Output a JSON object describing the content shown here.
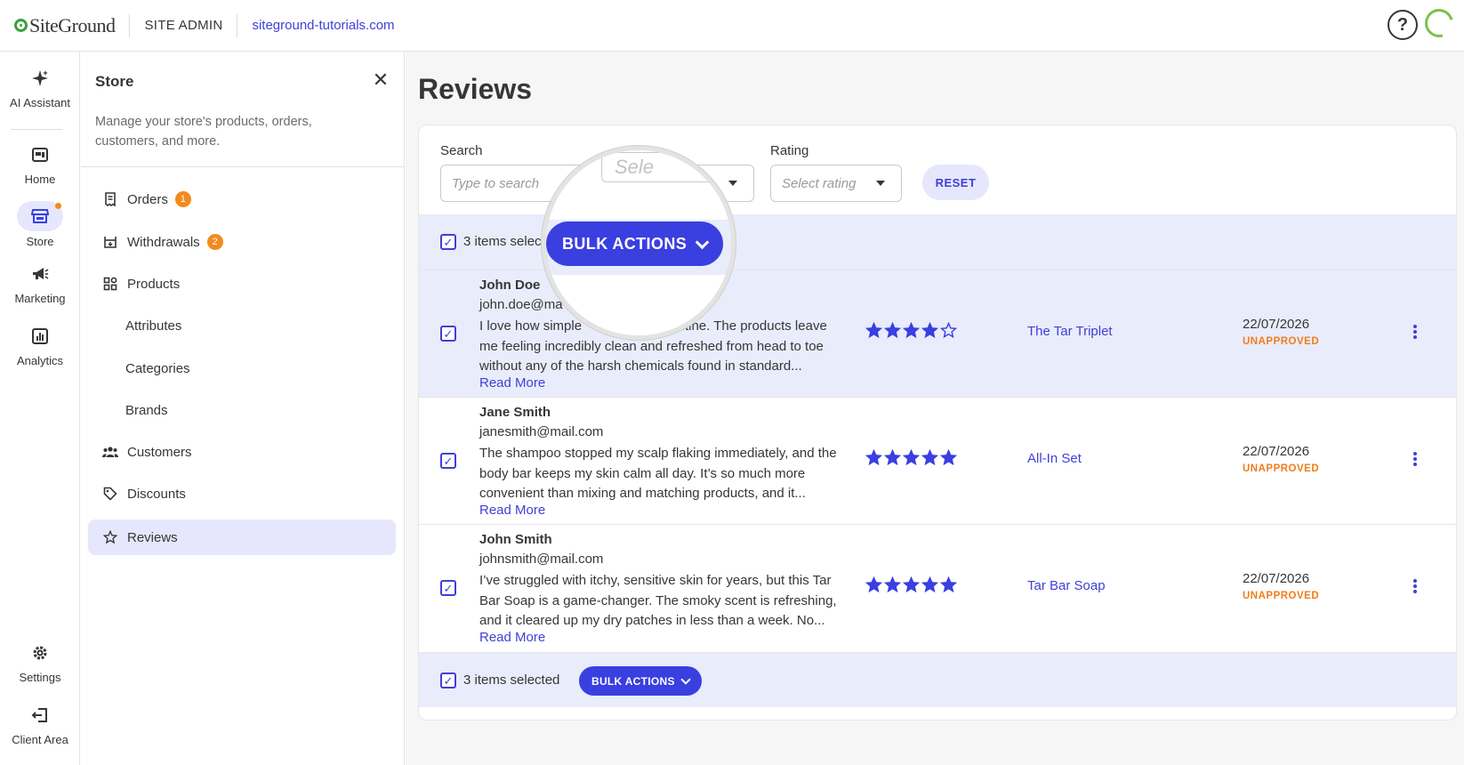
{
  "topbar": {
    "logo_text": "SiteGround",
    "section": "SITE ADMIN",
    "domain": "siteground-tutorials.com",
    "help_glyph": "?"
  },
  "rail": {
    "items": [
      {
        "label": "AI Assistant",
        "icon": "sparkle-icon"
      },
      {
        "label": "Home",
        "icon": "home-icon"
      },
      {
        "label": "Store",
        "icon": "store-icon",
        "active": true
      },
      {
        "label": "Marketing",
        "icon": "megaphone-icon"
      },
      {
        "label": "Analytics",
        "icon": "analytics-icon"
      },
      {
        "label": "Settings",
        "icon": "gear-icon"
      },
      {
        "label": "Client Area",
        "icon": "exit-icon"
      }
    ]
  },
  "panel": {
    "title": "Store",
    "description": "Manage your store's products, orders, customers, and more.",
    "nav": [
      {
        "label": "Orders",
        "badge": "1",
        "icon": "receipt-icon"
      },
      {
        "label": "Withdrawals",
        "badge": "2",
        "icon": "withdrawal-icon"
      },
      {
        "label": "Products",
        "icon": "products-icon"
      },
      {
        "label": "Attributes"
      },
      {
        "label": "Categories"
      },
      {
        "label": "Brands"
      },
      {
        "label": "Customers",
        "icon": "customers-icon"
      },
      {
        "label": "Discounts",
        "icon": "tag-icon"
      },
      {
        "label": "Reviews",
        "icon": "star-icon",
        "active": true
      }
    ]
  },
  "main": {
    "title": "Reviews",
    "filters": {
      "search_label": "Search",
      "search_placeholder": "Type to search",
      "status_placeholder": "Sele",
      "rating_label": "Rating",
      "rating_placeholder": "Select rating",
      "reset_label": "RESET"
    },
    "bulk_top": {
      "selected_text": "3 items selec",
      "button_label": "BULK ACTIONS"
    },
    "bulk_bottom": {
      "selected_text": "3 items selected",
      "button_label": "BULK ACTIONS"
    },
    "reviews": [
      {
        "name": "John Doe",
        "email": "john.doe@ma",
        "text_line1_a": "I love how simple",
        "text_line1_b": "y routine. The products",
        "text_rest": "leave me feeling incredibly clean and refreshed from head to toe without any of the harsh chemicals found in standard...",
        "read_more": "Read More",
        "rating": 4,
        "product": "The Tar Triplet",
        "date": "22/07/2026",
        "status": "UNAPPROVED"
      },
      {
        "name": "Jane Smith",
        "email": "janesmith@mail.com",
        "text": "The shampoo stopped my scalp flaking immediately, and the body bar keeps my skin calm all day. It’s so much more convenient than mixing and matching products, and it...",
        "read_more": "Read More",
        "rating": 5,
        "product": "All-In Set",
        "date": "22/07/2026",
        "status": "UNAPPROVED"
      },
      {
        "name": "John Smith",
        "email": "johnsmith@mail.com",
        "text": "I’ve struggled with itchy, sensitive skin for years, but this Tar Bar Soap is a game-changer. The smoky scent is refreshing, and it cleared up my dry patches in less than a week. No...",
        "read_more": "Read More",
        "rating": 5,
        "product": "Tar Bar Soap",
        "date": "22/07/2026",
        "status": "UNAPPROVED"
      }
    ],
    "colors": {
      "accent": "#3a3fe0",
      "selection_bg": "#e9ecfb",
      "status_unapproved": "#ef7d1c",
      "badge": "#f28b1d"
    }
  }
}
